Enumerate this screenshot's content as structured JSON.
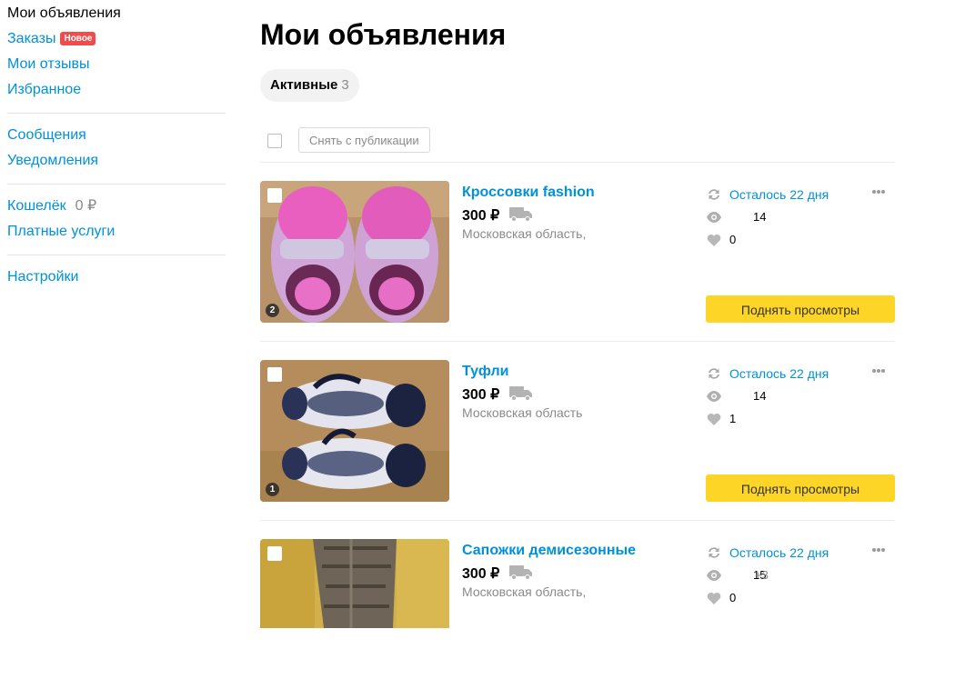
{
  "sidebar": {
    "my_ads": "Мои объявления",
    "orders": "Заказы",
    "orders_badge": "Новое",
    "reviews": "Мои отзывы",
    "favorites": "Избранное",
    "messages": "Сообщения",
    "notifications": "Уведомления",
    "wallet": "Кошелёк",
    "wallet_amount": "0 ₽",
    "paid_services": "Платные услуги",
    "settings": "Настройки"
  },
  "page_title": "Мои объявления",
  "tab": {
    "label": "Активные",
    "count": "3"
  },
  "toolbar": {
    "unpublish_label": "Снять с публикации"
  },
  "colors": {
    "link": "#0091d9",
    "badge": "#f24b4b",
    "raise_button": "#fdd527"
  },
  "items": [
    {
      "title": "Кроссовки fashion",
      "price": "300 ₽",
      "location": "Московская область,",
      "photo_count": "2",
      "days_left": "Осталось 22 дня",
      "views": "14",
      "views_plus": "",
      "favorites": "0",
      "raise_label": "Поднять просмотры"
    },
    {
      "title": "Туфли",
      "price": "300 ₽",
      "location": "Московская область",
      "photo_count": "1",
      "days_left": "Осталось 22 дня",
      "views": "14",
      "views_plus": "",
      "favorites": "1",
      "raise_label": "Поднять просмотры"
    },
    {
      "title": "Сапожки демисезонные",
      "price": "300 ₽",
      "location": "Московская область,",
      "photo_count": "",
      "days_left": "Осталось 22 дня",
      "views": "15",
      "views_plus": "+3",
      "favorites": "0",
      "raise_label": ""
    }
  ],
  "icons": [
    "refresh-icon",
    "eye-icon",
    "heart-icon",
    "delivery-truck-icon",
    "more-dots-icon"
  ]
}
